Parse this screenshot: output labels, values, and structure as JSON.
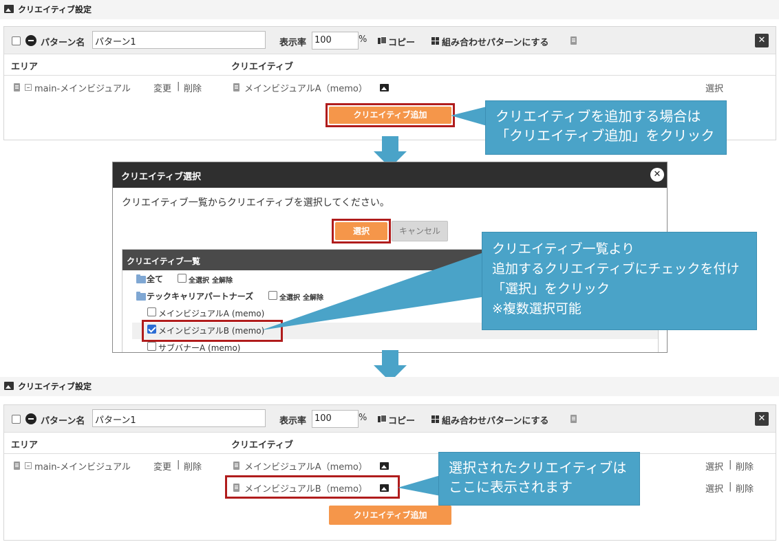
{
  "top": {
    "section_title": "クリエイティブ設定",
    "pattern_label": "パターン名",
    "pattern_value": "パターン1",
    "rate_label": "表示率",
    "rate_value": "100",
    "percent": "%",
    "copy_label": "コピー",
    "combine_label": "組み合わせパターンにする",
    "close_glyph": "✕",
    "area_header": "エリア",
    "creative_header": "クリエイティブ",
    "area_name": "main-メインビジュアル",
    "edit_label": "変更",
    "sep": "|",
    "delete_label": "削除",
    "creative_item": "メインビジュアルA（memo）",
    "select_label": "選択",
    "add_button": "クリエイティブ追加"
  },
  "callout1": {
    "line1": "クリエイティブを追加する場合は",
    "line2": "「クリエイティブ追加」をクリック"
  },
  "dialog": {
    "title": "クリエイティブ選択",
    "close_glyph": "✕",
    "instruction": "クリエイティブ一覧からクリエイティブを選択してください。",
    "select_button": "選択",
    "cancel_button": "キャンセル",
    "list_title": "クリエイティブ一覧",
    "all_label": "全て",
    "select_all": "全選択",
    "deselect_all": "全解除",
    "folder_label": "テックキャリアパートナーズ",
    "items": [
      {
        "label": "メインビジュアルA (memo)",
        "checked": false
      },
      {
        "label": "メインビジュアルB (memo)",
        "checked": true
      },
      {
        "label": "サブバナーA (memo)",
        "checked": false
      }
    ]
  },
  "callout2": {
    "line1": "クリエイティブ一覧より",
    "line2": "追加するクリエイティブにチェックを付け",
    "line3": "「選択」をクリック",
    "line4": "※複数選択可能"
  },
  "bottom": {
    "section_title": "クリエイティブ設定",
    "pattern_label": "パターン名",
    "pattern_value": "パターン1",
    "rate_label": "表示率",
    "rate_value": "100",
    "percent": "%",
    "copy_label": "コピー",
    "combine_label": "組み合わせパターンにする",
    "close_glyph": "✕",
    "area_header": "エリア",
    "creative_header": "クリエイティブ",
    "area_name": "main-メインビジュアル",
    "edit_label": "変更",
    "sep": "|",
    "delete_label": "削除",
    "creative_item_a": "メインビジュアルA（memo）",
    "creative_item_b": "メインビジュアルB（memo）",
    "select_label": "選択",
    "add_button": "クリエイティブ追加"
  },
  "callout3": {
    "line1": "選択されたクリエイティブは",
    "line2": "ここに表示されます"
  },
  "colors": {
    "accent_orange": "#f5964a",
    "highlight_red": "#b01c1c",
    "callout_blue": "#4aa3c8",
    "dialog_header": "#2f2f2f"
  }
}
